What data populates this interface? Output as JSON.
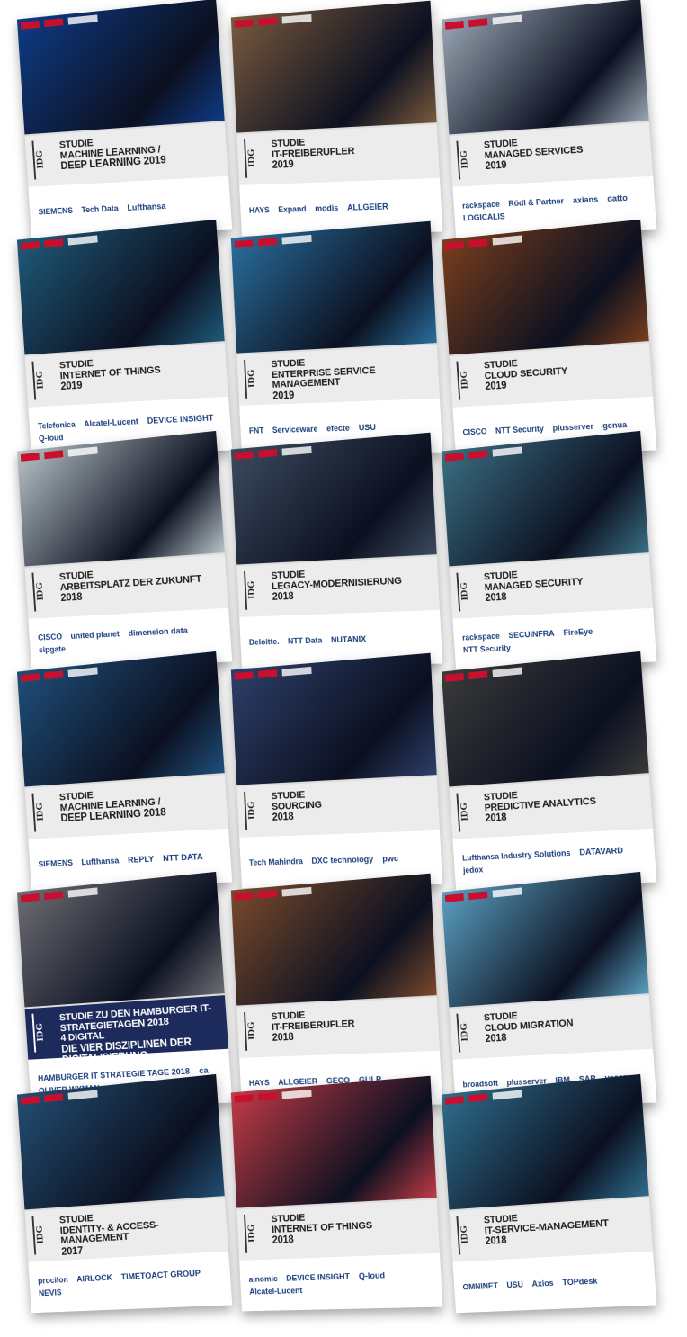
{
  "covers": [
    {
      "label": "STUDIE",
      "line1": "MACHINE LEARNING /",
      "line2": "DEEP LEARNING 2019",
      "year": "",
      "logo": "IDG",
      "partners": [
        "SIEMENS",
        "Tech Data",
        "Lufthansa"
      ],
      "bg": "#0f3b86"
    },
    {
      "label": "STUDIE",
      "line1": "IT-FREIBERUFLER",
      "line2": "",
      "year": "2019",
      "logo": "IDG",
      "partners": [
        "HAYS",
        "Expand",
        "modis",
        "ALLGEIER"
      ],
      "bg": "#7a5a3d"
    },
    {
      "label": "STUDIE",
      "line1": "MANAGED SERVICES",
      "line2": "",
      "year": "2019",
      "logo": "IDG",
      "partners": [
        "rackspace",
        "Rödl & Partner",
        "axians",
        "datto",
        "LOGICALIS"
      ],
      "bg": "#9aa7b4"
    },
    {
      "label": "STUDIE",
      "line1": "INTERNET OF THINGS",
      "line2": "",
      "year": "2019",
      "logo": "IDG",
      "partners": [
        "Telefonica",
        "Alcatel-Lucent",
        "DEVICE INSIGHT",
        "Q-loud"
      ],
      "bg": "#1f5a79"
    },
    {
      "label": "STUDIE",
      "line1": "ENTERPRISE SERVICE MANAGEMENT",
      "line2": "",
      "year": "2019",
      "logo": "IDG",
      "partners": [
        "FNT",
        "Serviceware",
        "efecte",
        "USU"
      ],
      "bg": "#2a6f9e"
    },
    {
      "label": "STUDIE",
      "line1": "CLOUD SECURITY",
      "line2": "",
      "year": "2019",
      "logo": "IDG",
      "partners": [
        "CISCO",
        "NTT Security",
        "plusserver",
        "genua"
      ],
      "bg": "#7a3e1c"
    },
    {
      "label": "STUDIE",
      "line1": "ARBEITSPLATZ DER ZUKUNFT",
      "line2": "",
      "year": "2018",
      "logo": "IDG",
      "partners": [
        "CISCO",
        "united planet",
        "dimension data",
        "sipgate"
      ],
      "bg": "#b8c3c8"
    },
    {
      "label": "STUDIE",
      "line1": "LEGACY-MODERNISIERUNG",
      "line2": "",
      "year": "2018",
      "logo": "IDG",
      "partners": [
        "Deloitte.",
        "NTT Data",
        "NUTANIX"
      ],
      "bg": "#3c4a5e"
    },
    {
      "label": "STUDIE",
      "line1": "MANAGED SECURITY",
      "line2": "",
      "year": "2018",
      "logo": "IDG",
      "partners": [
        "rackspace",
        "SECUINFRA",
        "FireEye",
        "NTT Security"
      ],
      "bg": "#3b6f84"
    },
    {
      "label": "STUDIE",
      "line1": "MACHINE LEARNING /",
      "line2": "DEEP LEARNING 2018",
      "year": "",
      "logo": "IDG",
      "partners": [
        "SIEMENS",
        "Lufthansa",
        "REPLY",
        "NTT DATA"
      ],
      "bg": "#1f4f7b"
    },
    {
      "label": "STUDIE",
      "line1": "SOURCING",
      "line2": "",
      "year": "2018",
      "logo": "IDG",
      "partners": [
        "Tech Mahindra",
        "DXC technology",
        "pwc"
      ],
      "bg": "#2e3f6a"
    },
    {
      "label": "STUDIE",
      "line1": "PREDICTIVE ANALYTICS",
      "line2": "",
      "year": "2018",
      "logo": "IDG",
      "partners": [
        "Lufthansa Industry Solutions",
        "DATAVARD",
        "jedox"
      ],
      "bg": "#3a3a3a"
    },
    {
      "label": "STUDIE ZU DEN HAMBURGER IT-STRATEGIETAGEN 2018",
      "line1": "4 DIGITAL",
      "line2": "DIE VIER DISZIPLINEN DER DIGITALISIERUNG",
      "year": "",
      "logo": "IDG",
      "partners": [
        "HAMBURGER IT STRATEGIE TAGE 2018",
        "ca",
        "OLIVER WYMAN"
      ],
      "bg": "#6d6d73",
      "dark": true
    },
    {
      "label": "STUDIE",
      "line1": "IT-FREIBERUFLER",
      "line2": "",
      "year": "2018",
      "logo": "IDG",
      "partners": [
        "HAYS",
        "ALLGEIER",
        "GECO",
        "GULP"
      ],
      "bg": "#7a4a2c"
    },
    {
      "label": "STUDIE",
      "line1": "CLOUD MIGRATION",
      "line2": "",
      "year": "2018",
      "logo": "IDG",
      "partners": [
        "broadsoft",
        "plusserver",
        "IBM",
        "SAP",
        "veeam"
      ],
      "bg": "#5aa0c2"
    },
    {
      "label": "STUDIE",
      "line1": "IDENTITY- & ACCESS-MANAGEMENT",
      "line2": "",
      "year": "2017",
      "logo": "IDG",
      "partners": [
        "procilon",
        "AIRLOCK",
        "TIMETOACT GROUP",
        "NEVIS"
      ],
      "bg": "#234e73"
    },
    {
      "label": "STUDIE",
      "line1": "INTERNET OF THINGS",
      "line2": "",
      "year": "2018",
      "logo": "IDG",
      "partners": [
        "ainomic",
        "DEVICE INSIGHT",
        "Q-loud",
        "Alcatel-Lucent"
      ],
      "bg": "#c33b46"
    },
    {
      "label": "STUDIE",
      "line1": "IT-SERVICE-MANAGEMENT",
      "line2": "",
      "year": "2018",
      "logo": "IDG",
      "partners": [
        "OMNINET",
        "USU",
        "Axios",
        "TOPdesk"
      ],
      "bg": "#2f6e8e"
    }
  ]
}
